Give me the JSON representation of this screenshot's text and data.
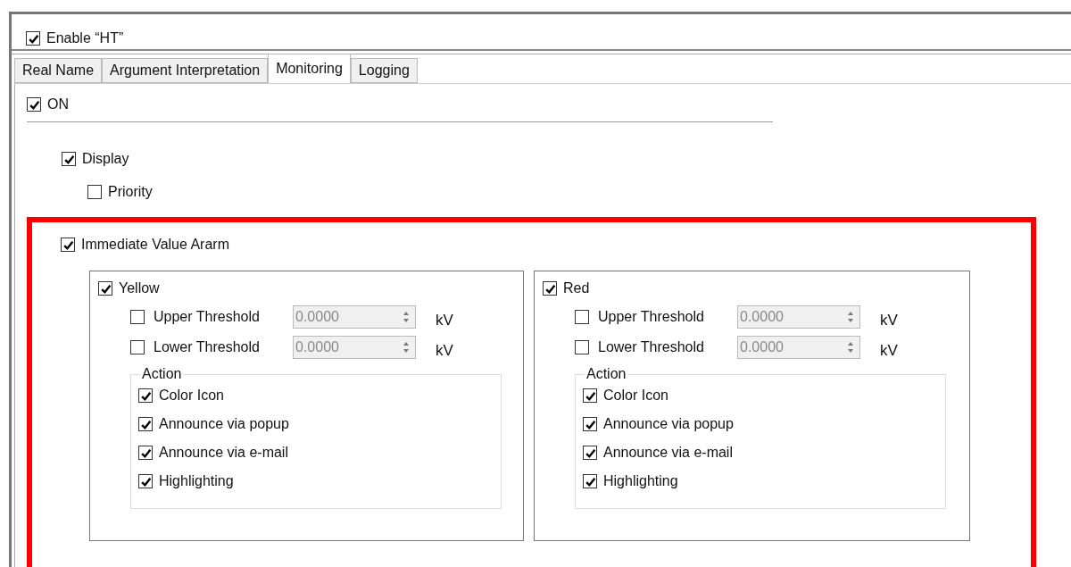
{
  "enable": {
    "label": "Enable “HT”",
    "checked": true
  },
  "tabs": [
    {
      "label": "Real Name",
      "selected": false
    },
    {
      "label": "Argument Interpretation",
      "selected": false
    },
    {
      "label": "Monitoring",
      "selected": true
    },
    {
      "label": "Logging",
      "selected": false
    }
  ],
  "on": {
    "label": "ON",
    "checked": true
  },
  "display": {
    "label": "Display",
    "checked": true
  },
  "priority": {
    "label": "Priority",
    "checked": false
  },
  "alarm": {
    "label": "Immediate Value Ararm",
    "checked": true,
    "groups": [
      {
        "label": "Yellow",
        "checked": true,
        "thresholds": [
          {
            "label": "Upper Threshold",
            "checked": false,
            "value": "0.0000",
            "disabled": true,
            "unit": "kV"
          },
          {
            "label": "Lower Threshold",
            "checked": false,
            "value": "0.0000",
            "disabled": true,
            "unit": "kV"
          }
        ],
        "action": {
          "title": "Action",
          "items": [
            {
              "label": "Color Icon",
              "checked": true
            },
            {
              "label": "Announce via popup",
              "checked": true
            },
            {
              "label": "Announce via e-mail",
              "checked": true
            },
            {
              "label": "Highlighting",
              "checked": true
            }
          ]
        }
      },
      {
        "label": "Red",
        "checked": true,
        "thresholds": [
          {
            "label": "Upper Threshold",
            "checked": false,
            "value": "0.0000",
            "disabled": true,
            "unit": "kV"
          },
          {
            "label": "Lower Threshold",
            "checked": false,
            "value": "0.0000",
            "disabled": true,
            "unit": "kV"
          }
        ],
        "action": {
          "title": "Action",
          "items": [
            {
              "label": "Color Icon",
              "checked": true
            },
            {
              "label": "Announce via popup",
              "checked": true
            },
            {
              "label": "Announce via e-mail",
              "checked": true
            },
            {
              "label": "Highlighting",
              "checked": true
            }
          ]
        }
      }
    ]
  }
}
